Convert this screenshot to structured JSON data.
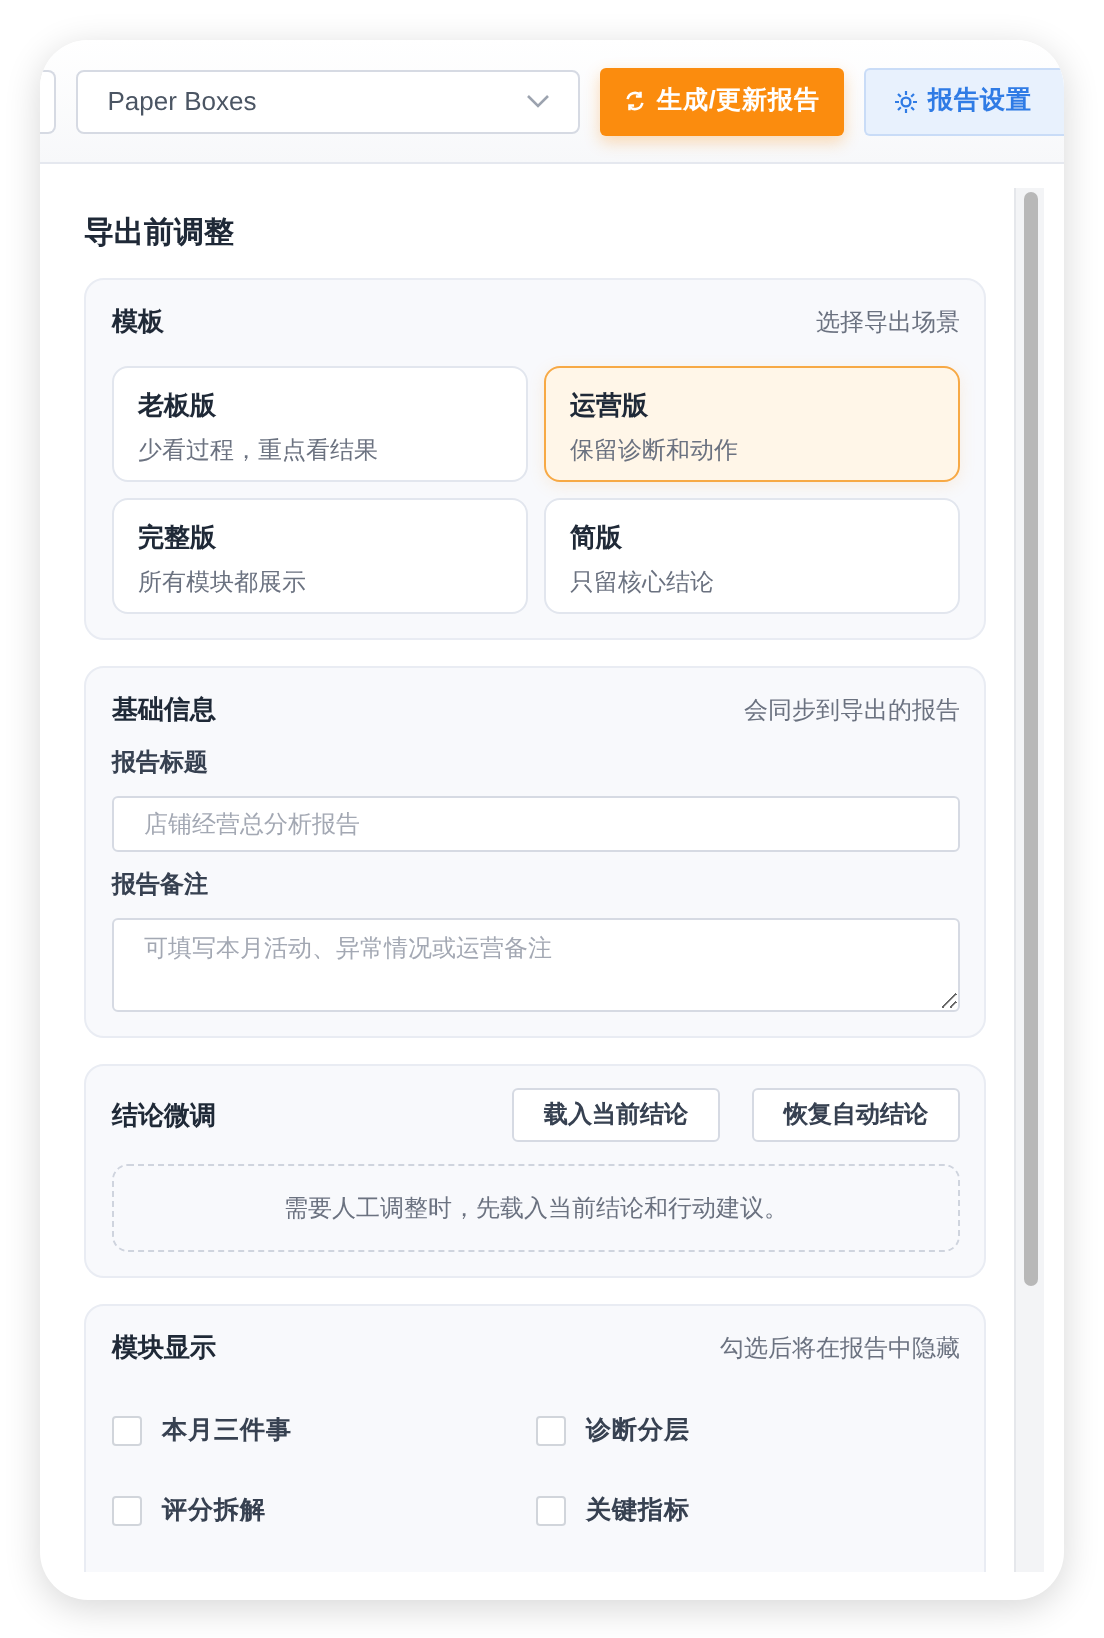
{
  "toolbar": {
    "store_select": {
      "value": "Paper Boxes"
    },
    "generate_button": {
      "label": "生成/更新报告"
    },
    "settings_button": {
      "label": "报告设置"
    }
  },
  "panel": {
    "title": "导出前调整",
    "template": {
      "title": "模板",
      "hint": "选择导出场景",
      "options": [
        {
          "name": "老板版",
          "desc": "少看过程，重点看结果",
          "selected": false
        },
        {
          "name": "运营版",
          "desc": "保留诊断和动作",
          "selected": true
        },
        {
          "name": "完整版",
          "desc": "所有模块都展示",
          "selected": false
        },
        {
          "name": "简版",
          "desc": "只留核心结论",
          "selected": false
        }
      ]
    },
    "basic_info": {
      "title": "基础信息",
      "hint": "会同步到导出的报告",
      "fields": [
        {
          "label": "报告标题",
          "placeholder": "店铺经营总分析报告",
          "kind": "input"
        },
        {
          "label": "报告备注",
          "placeholder": "可填写本月活动、异常情况或运营备注",
          "kind": "textarea"
        }
      ]
    },
    "conclusion": {
      "title": "结论微调",
      "buttons": [
        "载入当前结论",
        "恢复自动结论"
      ],
      "empty_text": "需要人工调整时，先载入当前结论和行动建议。"
    },
    "modules": {
      "title": "模块显示",
      "hint": "勾选后将在报告中隐藏",
      "items": [
        {
          "label": "本月三件事",
          "checked": false
        },
        {
          "label": "诊断分层",
          "checked": false
        },
        {
          "label": "评分拆解",
          "checked": false
        },
        {
          "label": "关键指标",
          "checked": false
        }
      ]
    }
  }
}
